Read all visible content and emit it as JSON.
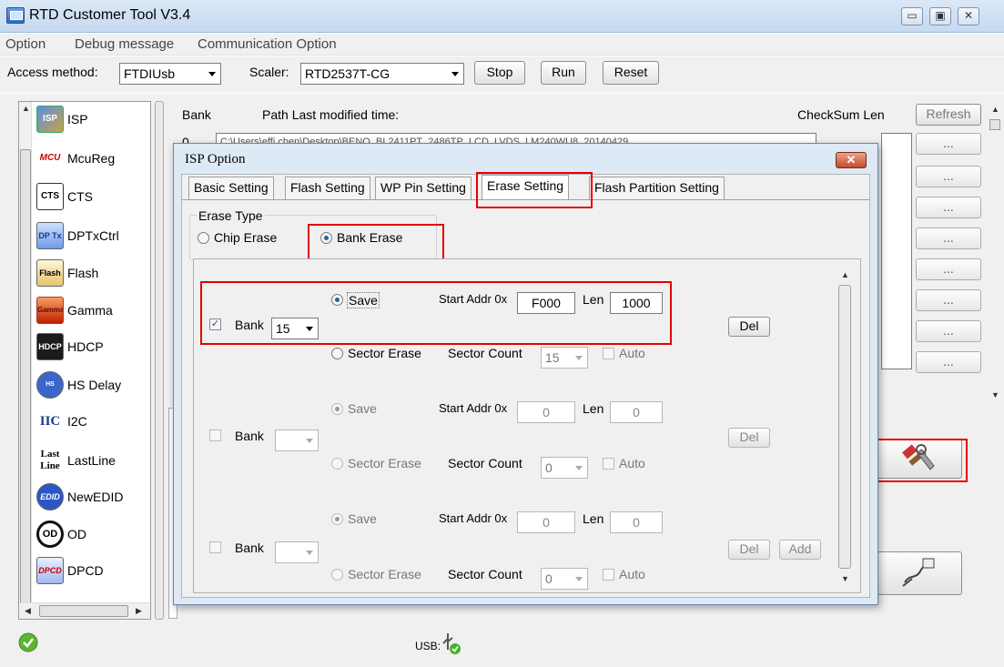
{
  "window": {
    "title": "RTD Customer Tool V3.4",
    "min": "▭",
    "max": "▣",
    "close": "✕"
  },
  "menu": [
    "Option",
    "Debug message",
    "Communication Option"
  ],
  "toolbar": {
    "access_label": "Access method:",
    "access_value": "FTDIUsb",
    "scaler_label": "Scaler:",
    "scaler_value": "RTD2537T-CG",
    "stop": "Stop",
    "run": "Run",
    "reset": "Reset"
  },
  "sidebar": {
    "items": [
      {
        "label": "ISP",
        "icon": "isp-icon",
        "icon_text": "ISP"
      },
      {
        "label": "McuReg",
        "icon": "mcu-icon",
        "icon_text": "MCU"
      },
      {
        "label": "CTS",
        "icon": "cts-icon",
        "icon_text": "CTS"
      },
      {
        "label": "DPTxCtrl",
        "icon": "dptx-icon",
        "icon_text": "DP Tx"
      },
      {
        "label": "Flash",
        "icon": "flash-icon",
        "icon_text": "Flash"
      },
      {
        "label": "Gamma",
        "icon": "gamma-icon",
        "icon_text": "Gamma"
      },
      {
        "label": "HDCP",
        "icon": "hdcp-icon",
        "icon_text": "HDCP"
      },
      {
        "label": "HS Delay",
        "icon": "hs-delay-icon",
        "icon_text": "HS Delay"
      },
      {
        "label": "I2C",
        "icon": "i2c-icon",
        "icon_text": "IIC"
      },
      {
        "label": "LastLine",
        "icon": "lastline-icon",
        "icon_text": "Last Line"
      },
      {
        "label": "NewEDID",
        "icon": "edid-icon",
        "icon_text": "EDID"
      },
      {
        "label": "OD",
        "icon": "od-icon",
        "icon_text": "OD"
      },
      {
        "label": "DPCD",
        "icon": "dpcd-icon",
        "icon_text": "DPCD"
      }
    ]
  },
  "main": {
    "col_bank": "Bank",
    "col_path": "Path  Last modified time:",
    "col_checksum": "CheckSum Len",
    "refresh": "Refresh",
    "row0_index": "0",
    "row0_path": "C:\\Users\\effi.chen\\Desktop\\BENQ_BL2411PT_2486TP_LCD_LVDS_LM240WU8_20140429",
    "dots": "..."
  },
  "dialog": {
    "title": "ISP Option",
    "close": "✕",
    "tabs": [
      "Basic Setting",
      "Flash Setting",
      "WP Pin Setting",
      "Erase Setting",
      "Flash Partition Setting"
    ],
    "erase_type_label": "Erase Type",
    "chip_erase": "Chip Erase",
    "bank_erase": "Bank Erase",
    "save": "Save",
    "start_addr": "Start Addr 0x",
    "len": "Len",
    "sector_erase": "Sector Erase",
    "sector_count": "Sector Count",
    "auto": "Auto",
    "bank": "Bank",
    "del": "Del",
    "add": "Add",
    "entry1": {
      "bank": "15",
      "start": "F000",
      "len": "1000",
      "sector_count": "15"
    },
    "entry2": {
      "start": "0",
      "len": "0",
      "sector_count": "0"
    },
    "entry3": {
      "start": "0",
      "len": "0",
      "sector_count": "0"
    }
  },
  "status": {
    "usb": "USB:"
  },
  "colors": {
    "highlight": "#e60000",
    "accent": "#2a5ea8"
  }
}
